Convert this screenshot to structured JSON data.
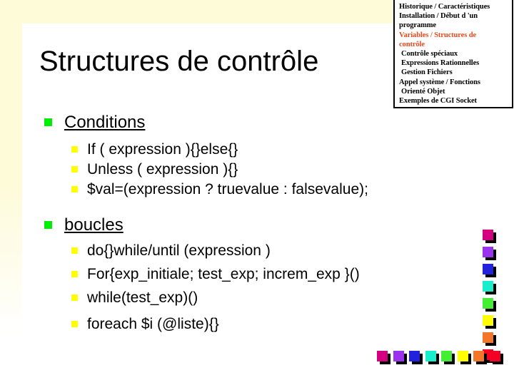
{
  "slide": {
    "title": "Structures de contrôle",
    "background_color": "#ffffff",
    "frame_color": "#fdfbd8"
  },
  "nav_box": {
    "accent_color": "#e8491d",
    "text_color": "#000000",
    "items": [
      {
        "label": "Historique / Caractéristiques",
        "active": false,
        "indent": false
      },
      {
        "label": "Installation / Début d 'un",
        "active": false,
        "indent": false
      },
      {
        "label": "programme",
        "active": false,
        "indent": false
      },
      {
        "label": "Variables  / Structures de",
        "active": true,
        "indent": false
      },
      {
        "label": "contrôle",
        "active": true,
        "indent": false
      },
      {
        "label": "Contrôle spéciaux",
        "active": false,
        "indent": true
      },
      {
        "label": "Expressions Rationnelles",
        "active": false,
        "indent": true
      },
      {
        "label": "Gestion Fichiers",
        "active": false,
        "indent": true
      },
      {
        "label": "Appel système / Fonctions",
        "active": false,
        "indent": false
      },
      {
        "label": "Orienté Objet",
        "active": false,
        "indent": true
      },
      {
        "label": "Exemples de CGI Socket",
        "active": false,
        "indent": false
      }
    ]
  },
  "content": {
    "sections": [
      {
        "heading": "Conditions",
        "marker_color": "#00ee00",
        "items": [
          "If ( expression ){}else{}",
          "Unless ( expression ){}",
          "$val=(expression  ?  truevalue  :  falsevalue);"
        ]
      },
      {
        "heading": "boucles",
        "marker_color": "#00ee00",
        "items": [
          "do{}while/until (expression )",
          "For{exp_initiale; test_exp; increm_exp }()",
          "while(test_exp)()",
          "foreach $i (@liste){}"
        ]
      }
    ],
    "sub_marker_color": "#ffff00"
  },
  "decoration": {
    "column_colors": [
      "#d4007f",
      "#9933ee",
      "#2222dd",
      "#18eecc",
      "#44ee33",
      "#ffff00",
      "#f4762b",
      "#f50025"
    ],
    "row_colors": [
      "#d4007f",
      "#9933ee",
      "#2222dd",
      "#18eecc",
      "#44ee33",
      "#ffff00",
      "#f4762b",
      "#f50025"
    ],
    "shadow_color": "#000000"
  }
}
